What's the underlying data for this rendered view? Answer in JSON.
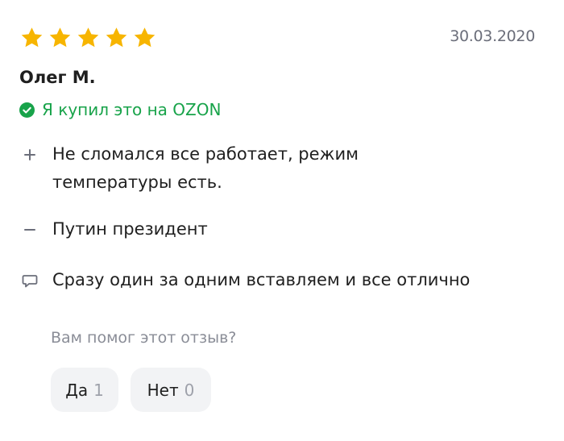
{
  "review": {
    "rating": 5,
    "rating_max": 5,
    "date": "30.03.2020",
    "author": "Олег М.",
    "verified_text": "Я купил это на OZON",
    "pros": "Не сломался все работает, режим температуры есть.",
    "cons": "Путин президент",
    "comment": "Сразу один за одним вставляем и все отлично"
  },
  "feedback": {
    "question": "Вам помог этот отзыв?",
    "yes_label": "Да",
    "yes_count": "1",
    "no_label": "Нет",
    "no_count": "0"
  },
  "colors": {
    "star": "#f7b500",
    "verified": "#18a34a",
    "muted": "#8a8d97",
    "button_bg": "#f2f3f5"
  },
  "icons": {
    "rating": "star-icon",
    "verified": "check-circle-icon",
    "pros": "plus-icon",
    "cons": "minus-icon",
    "comment": "comment-icon"
  }
}
